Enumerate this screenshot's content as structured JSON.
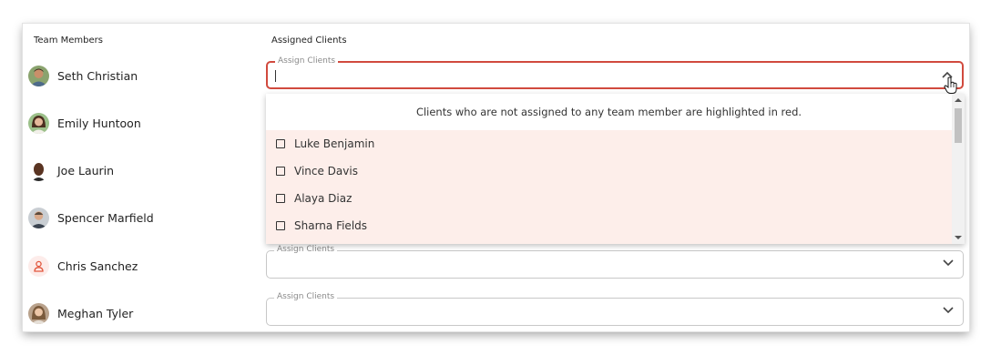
{
  "headers": {
    "members": "Team Members",
    "clients": "Assigned Clients"
  },
  "members": [
    {
      "name": "Seth Christian",
      "avatar": "photo-avatar"
    },
    {
      "name": "Emily Huntoon",
      "avatar": "photo-avatar"
    },
    {
      "name": "Joe Laurin",
      "avatar": "photo-avatar"
    },
    {
      "name": "Spencer Marfield",
      "avatar": "photo-avatar"
    },
    {
      "name": "Chris Sanchez",
      "avatar": "person-outline-icon"
    },
    {
      "name": "Meghan Tyler",
      "avatar": "photo-avatar"
    }
  ],
  "fields": {
    "label": "Assign Clients",
    "active_value": "",
    "chevron_up": "chevron-up-icon",
    "chevron_down": "chevron-down-icon"
  },
  "dropdown": {
    "note": "Clients who are not assigned to any team member are highlighted in red.",
    "options": [
      {
        "label": "Luke Benjamin",
        "checked": false
      },
      {
        "label": "Vince Davis",
        "checked": false
      },
      {
        "label": "Alaya Diaz",
        "checked": false
      },
      {
        "label": "Sharna Fields",
        "checked": false
      }
    ],
    "highlight_color": "#fdeeea"
  },
  "colors": {
    "active_border": "#d14a3e",
    "person_icon": "#e2553c"
  }
}
